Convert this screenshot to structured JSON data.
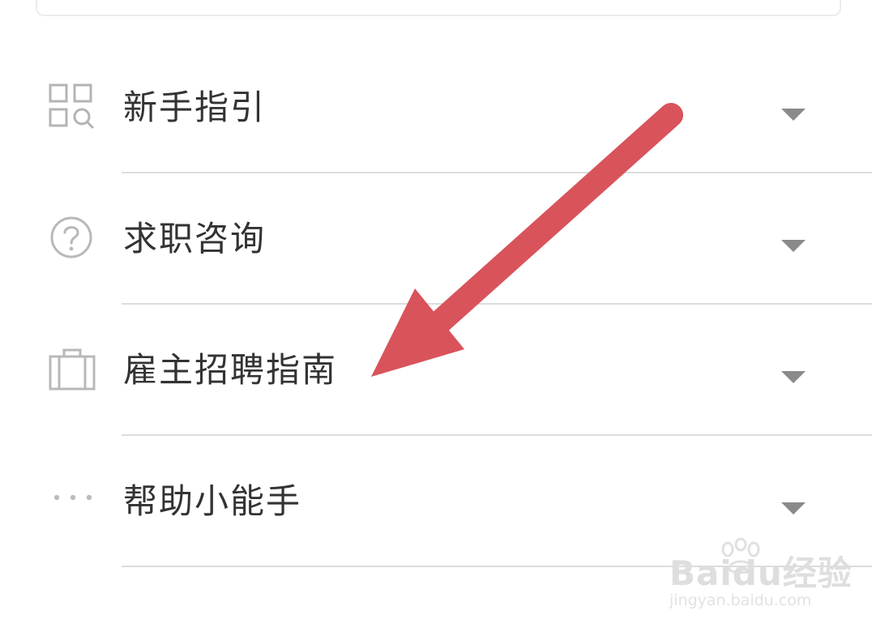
{
  "menu": {
    "items": [
      {
        "label": "新手指引",
        "icon": "apps-search-icon"
      },
      {
        "label": "求职咨询",
        "icon": "question-circle-icon"
      },
      {
        "label": "雇主招聘指南",
        "icon": "briefcase-icon"
      },
      {
        "label": "帮助小能手",
        "icon": "more-dots-icon"
      }
    ]
  },
  "annotation": {
    "arrow_color": "#d9535b"
  },
  "watermark": {
    "brand": "Baidu经验",
    "url": "jingyan.baidu.com"
  }
}
